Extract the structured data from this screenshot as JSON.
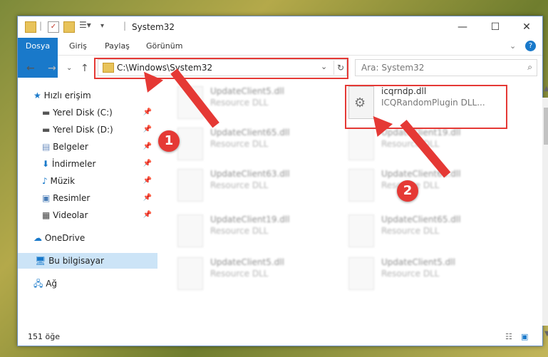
{
  "window": {
    "title": "System32",
    "ribbon_tabs": [
      "Dosya",
      "Giriş",
      "Paylaş",
      "Görünüm"
    ]
  },
  "address_bar": {
    "path": "C:\\Windows\\System32"
  },
  "search": {
    "placeholder": "Ara: System32"
  },
  "sidebar": {
    "items": [
      {
        "label": "Hızlı erişim"
      },
      {
        "label": "Yerel Disk (C:)"
      },
      {
        "label": "Yerel Disk (D:)"
      },
      {
        "label": "Belgeler"
      },
      {
        "label": "İndirmeler"
      },
      {
        "label": "Müzik"
      },
      {
        "label": "Resimler"
      },
      {
        "label": "Videolar"
      },
      {
        "label": "OneDrive"
      },
      {
        "label": "Bu bilgisayar"
      },
      {
        "label": "Ağ"
      }
    ]
  },
  "files": [
    {
      "name": "UpdateClient5.dll",
      "type": "Resource DLL"
    },
    {
      "name": "icqrndp.dll",
      "type": "ICQRandomPlugin DLL..."
    },
    {
      "name": "UpdateClient65.dll",
      "type": "Resource DLL"
    },
    {
      "name": "UpdateClient19.dll",
      "type": "Resource DLL"
    },
    {
      "name": "UpdateClient63.dll",
      "type": "Resource DLL"
    },
    {
      "name": "UpdateClient65.dll",
      "type": "Resource DLL"
    },
    {
      "name": "UpdateClient19.dll",
      "type": "Resource DLL"
    },
    {
      "name": "UpdateClient65.dll",
      "type": "Resource DLL"
    },
    {
      "name": "UpdateClient5.dll",
      "type": "Resource DLL"
    },
    {
      "name": "UpdateClient5.dll",
      "type": "Resource DLL"
    }
  ],
  "status": {
    "count": "151 öğe"
  },
  "callouts": {
    "one": "1",
    "two": "2"
  },
  "colors": {
    "accent": "#1979ca",
    "highlight": "#e53935",
    "selection": "#cce4f7"
  }
}
